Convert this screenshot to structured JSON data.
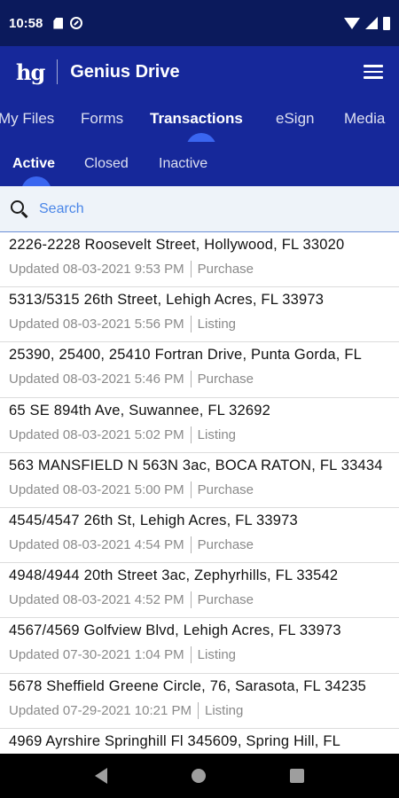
{
  "status": {
    "time": "10:58"
  },
  "app": {
    "logo": "hg",
    "title": "Genius Drive"
  },
  "main_tabs": [
    {
      "label": "My Files"
    },
    {
      "label": "Forms"
    },
    {
      "label": "Transactions",
      "active": true
    },
    {
      "label": "eSign"
    },
    {
      "label": "Media"
    }
  ],
  "sub_tabs": [
    {
      "label": "Active",
      "active": true
    },
    {
      "label": "Closed"
    },
    {
      "label": "Inactive"
    }
  ],
  "search": {
    "placeholder": "Search"
  },
  "transactions": [
    {
      "address": "2226-2228 Roosevelt Street, Hollywood, FL 33020",
      "updated": "Updated 08-03-2021 9:53 PM",
      "type": "Purchase"
    },
    {
      "address": "5313/5315 26th Street, Lehigh Acres, FL 33973",
      "updated": "Updated 08-03-2021 5:56 PM",
      "type": "Listing"
    },
    {
      "address": "25390, 25400, 25410 Fortran Drive, Punta Gorda, FL",
      "updated": "Updated 08-03-2021 5:46 PM",
      "type": "Purchase"
    },
    {
      "address": "65 SE 894th Ave, Suwannee, FL 32692",
      "updated": "Updated 08-03-2021 5:02 PM",
      "type": "Listing"
    },
    {
      "address": "563 MANSFIELD N 563N 3ac, BOCA RATON, FL 33434",
      "updated": "Updated 08-03-2021 5:00 PM",
      "type": "Purchase"
    },
    {
      "address": "4545/4547 26th St, Lehigh Acres, FL 33973",
      "updated": "Updated 08-03-2021 4:54 PM",
      "type": "Purchase"
    },
    {
      "address": "4948/4944 20th Street 3ac, Zephyrhills, FL 33542",
      "updated": "Updated 08-03-2021 4:52 PM",
      "type": "Purchase"
    },
    {
      "address": "4567/4569 Golfview Blvd, Lehigh Acres, FL 33973",
      "updated": "Updated 07-30-2021 1:04 PM",
      "type": "Listing"
    },
    {
      "address": "5678 Sheffield Greene Circle, 76, Sarasota, FL 34235",
      "updated": "Updated 07-29-2021 10:21 PM",
      "type": "Listing"
    },
    {
      "address": "4969 Ayrshire Springhill Fl 345609, Spring Hill, FL",
      "updated": "",
      "type": ""
    }
  ],
  "colors": {
    "statusbar": "#0b1a5c",
    "header": "#16289a",
    "indicator": "#3a66f0",
    "search_bg": "#eef3f9"
  }
}
